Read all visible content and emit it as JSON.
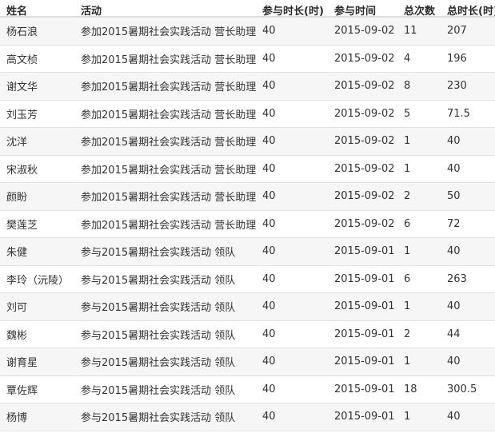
{
  "columns": {
    "name": "姓名",
    "activity": "活动",
    "hours": "参与时长(时)",
    "date": "参与时间",
    "count": "总次数",
    "total": "总时长(时)"
  },
  "rows": [
    {
      "name": "杨石浪",
      "activity": "参加2015暑期社会实践活动 营长助理",
      "hours": "40",
      "date": "2015-09-02",
      "count": "11",
      "total": "207"
    },
    {
      "name": "高文桢",
      "activity": "参加2015暑期社会实践活动 营长助理",
      "hours": "40",
      "date": "2015-09-02",
      "count": "4",
      "total": "196"
    },
    {
      "name": "谢文华",
      "activity": "参加2015暑期社会实践活动 营长助理",
      "hours": "40",
      "date": "2015-09-02",
      "count": "8",
      "total": "230"
    },
    {
      "name": "刘玉芳",
      "activity": "参加2015暑期社会实践活动 营长助理",
      "hours": "40",
      "date": "2015-09-02",
      "count": "5",
      "total": "71.5"
    },
    {
      "name": "沈洋",
      "activity": "参加2015暑期社会实践活动 营长助理",
      "hours": "40",
      "date": "2015-09-02",
      "count": "1",
      "total": "40"
    },
    {
      "name": "宋淑秋",
      "activity": "参加2015暑期社会实践活动 营长助理",
      "hours": "40",
      "date": "2015-09-02",
      "count": "1",
      "total": "40"
    },
    {
      "name": "颜盼",
      "activity": "参加2015暑期社会实践活动 营长助理",
      "hours": "40",
      "date": "2015-09-02",
      "count": "2",
      "total": "50"
    },
    {
      "name": "樊莲芝",
      "activity": "参加2015暑期社会实践活动 营长助理",
      "hours": "40",
      "date": "2015-09-02",
      "count": "6",
      "total": "72"
    },
    {
      "name": "朱健",
      "activity": "参与2015暑期社会实践活动 领队",
      "hours": "40",
      "date": "2015-09-01",
      "count": "1",
      "total": "40"
    },
    {
      "name": "李玲（沅陵）",
      "activity": "参与2015暑期社会实践活动 领队",
      "hours": "40",
      "date": "2015-09-01",
      "count": "6",
      "total": "263"
    },
    {
      "name": "刘可",
      "activity": "参与2015暑期社会实践活动 领队",
      "hours": "40",
      "date": "2015-09-01",
      "count": "1",
      "total": "40"
    },
    {
      "name": "魏彬",
      "activity": "参与2015暑期社会实践活动 领队",
      "hours": "40",
      "date": "2015-09-01",
      "count": "2",
      "total": "44"
    },
    {
      "name": "谢育星",
      "activity": "参与2015暑期社会实践活动 领队",
      "hours": "40",
      "date": "2015-09-01",
      "count": "1",
      "total": "40"
    },
    {
      "name": "覃佐辉",
      "activity": "参与2015暑期社会实践活动 领队",
      "hours": "40",
      "date": "2015-09-01",
      "count": "18",
      "total": "300.5"
    },
    {
      "name": "杨博",
      "activity": "参与2015暑期社会实践活动 领队",
      "hours": "40",
      "date": "2015-09-01",
      "count": "1",
      "total": "40"
    }
  ]
}
